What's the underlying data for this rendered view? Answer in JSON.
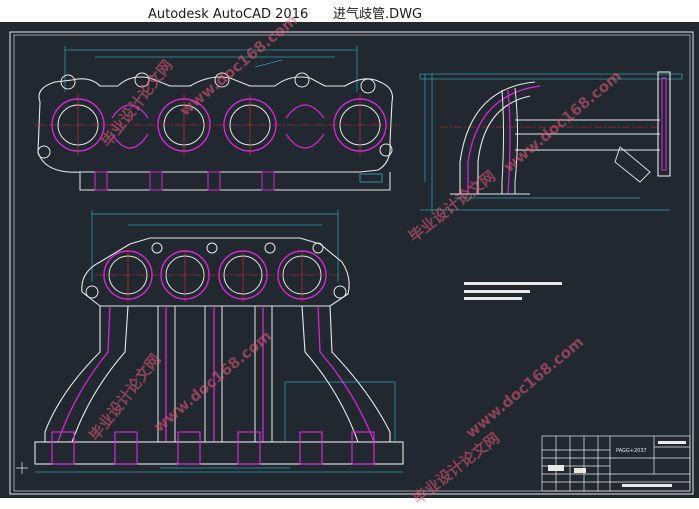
{
  "window": {
    "app_name": "Autodesk AutoCAD 2016",
    "file_name": "进气歧管.DWG"
  },
  "title_block": {
    "drawing_code": "PAGG+2037"
  },
  "watermarks": [
    "毕业设计论文网",
    "www.doc168.com"
  ],
  "colors": {
    "background": "#212830",
    "outline_white": "#e8e8e8",
    "magenta": "#d22ad2",
    "centerline_red": "#e23030",
    "dimension_cyan": "#38d8e8"
  }
}
